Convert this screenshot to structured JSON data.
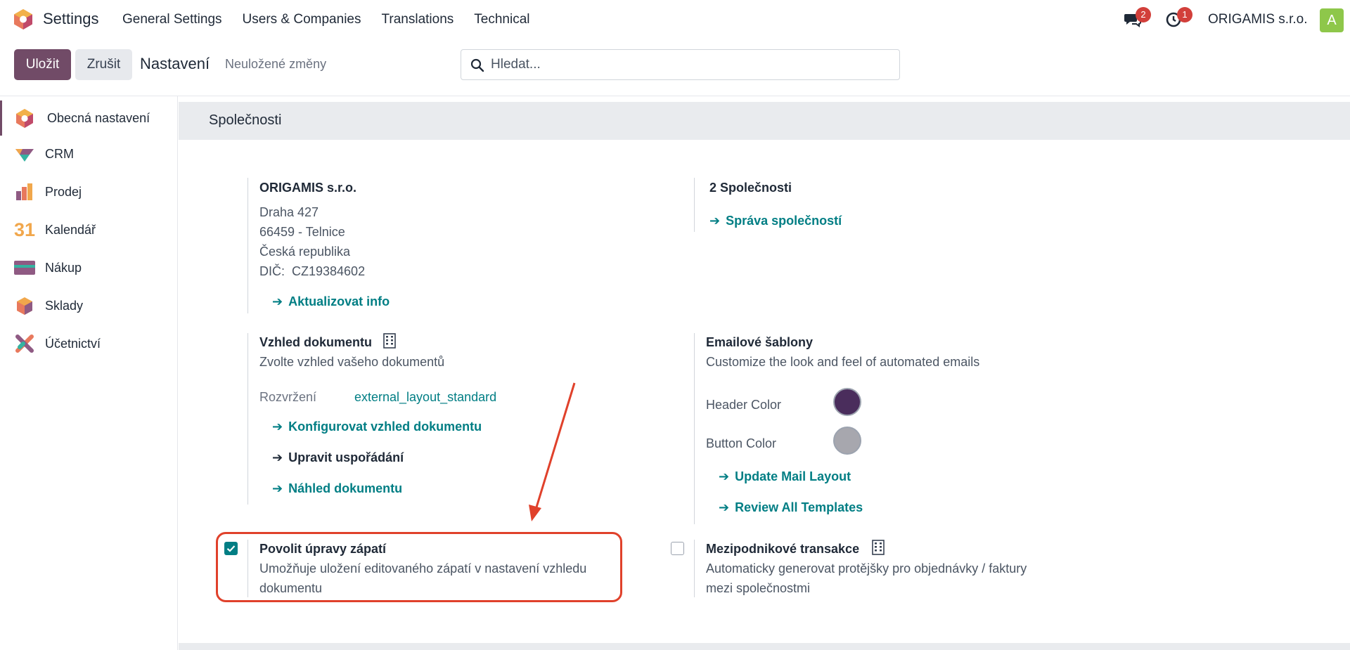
{
  "navbar": {
    "app_name": "Settings",
    "menu": [
      "General Settings",
      "Users & Companies",
      "Translations",
      "Technical"
    ],
    "messages_count": "2",
    "activities_count": "1",
    "company": "ORIGAMIS s.r.o.",
    "avatar_letter": "A"
  },
  "control_panel": {
    "save_label": "Uložit",
    "cancel_label": "Zrušit",
    "breadcrumb": "Nastavení",
    "status": "Neuložené změny",
    "search_placeholder": "Hledat..."
  },
  "sidebar": {
    "items": [
      {
        "label": "Obecná nastavení",
        "icon": "settings-icon",
        "active": true
      },
      {
        "label": "CRM",
        "icon": "crm-icon"
      },
      {
        "label": "Prodej",
        "icon": "sales-icon"
      },
      {
        "label": "Kalendář",
        "icon": "calendar-icon",
        "icon_text": "31"
      },
      {
        "label": "Nákup",
        "icon": "purchase-icon"
      },
      {
        "label": "Sklady",
        "icon": "inventory-icon"
      },
      {
        "label": "Účetnictví",
        "icon": "accounting-icon"
      }
    ]
  },
  "section": {
    "title": "Společnosti",
    "company": {
      "name": "ORIGAMIS s.r.o.",
      "street": "Draha 427",
      "city": "66459 - Telnice",
      "country": "Česká republika",
      "vat": "DIČ:  CZ19384602",
      "update_link": "Aktualizovat info"
    },
    "companies": {
      "count_label": "2 Společnosti",
      "manage_link": "Správa společností"
    },
    "document_layout": {
      "title": "Vzhled dokumentu",
      "description": "Zvolte vzhled vašeho dokumentů",
      "layout_label": "Rozvržení",
      "layout_value": "external_layout_standard",
      "configure_link": "Konfigurovat vzhled dokumentu",
      "edit_link": "Upravit uspořádání",
      "preview_link": "Náhled dokumentu"
    },
    "email_templates": {
      "title": "Emailové šablony",
      "description": "Customize the look and feel of automated emails",
      "header_color_label": "Header Color",
      "header_color": "#4a2d5c",
      "button_color_label": "Button Color",
      "button_color": "#a7a7ae",
      "update_layout_link": "Update Mail Layout",
      "review_link": "Review All Templates"
    },
    "footer_edit": {
      "title": "Povolit úpravy zápatí",
      "description_line1": "Umožňuje uložení editovaného zápatí v nastavení vzhledu",
      "description_line2": "dokumentu",
      "checked": true
    },
    "inter_company": {
      "title": "Mezipodnikové transakce",
      "description_line1": "Automaticky generovat protějšky pro objednávky / faktury",
      "description_line2": "mezi společnostmi",
      "checked": false
    }
  },
  "colors": {
    "brand": "#714b67",
    "link": "#017e84",
    "annotation": "#e0412b"
  }
}
